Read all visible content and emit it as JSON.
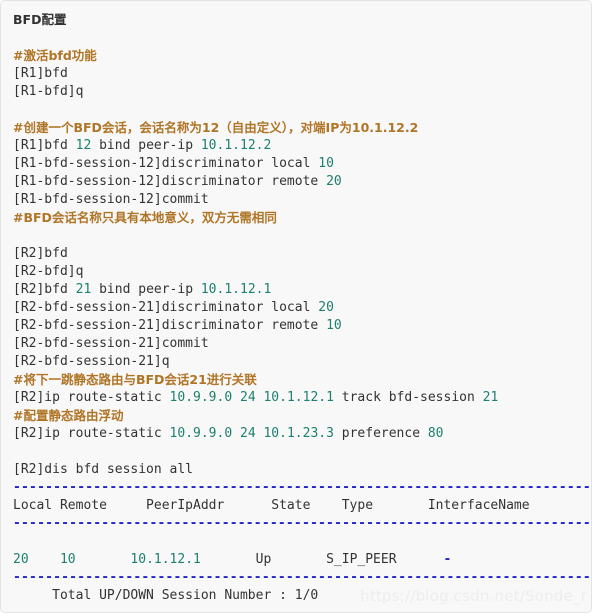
{
  "document": {
    "title": "BFD配置",
    "watermark": "https://blog.csdn.net/Sonde_r",
    "colors": {
      "background": "#f8f8f8",
      "border": "#e3e3e3",
      "code_text": "#333333",
      "comment": "#b07526",
      "number": "#1d7f6e",
      "separator": "#2222cc",
      "watermark": "#ededed"
    }
  },
  "lines": [
    {
      "id": "l01",
      "type": "title",
      "text": "BFD配置"
    },
    {
      "id": "l02",
      "type": "blank",
      "text": ""
    },
    {
      "id": "l03",
      "type": "comment",
      "text": "#激活bfd功能"
    },
    {
      "id": "l04",
      "type": "code",
      "text": "[R1]bfd"
    },
    {
      "id": "l05",
      "type": "code",
      "text": "[R1-bfd]q"
    },
    {
      "id": "l06",
      "type": "blank",
      "text": ""
    },
    {
      "id": "l07",
      "type": "comment",
      "text": "#创建一个BFD会话，会话名称为12（自由定义），对端IP为10.1.12.2"
    },
    {
      "id": "l08",
      "type": "code",
      "text": "[R1]bfd 12 bind peer-ip 10.1.12.2",
      "tokens": [
        {
          "t": "[R1]bfd ",
          "k": "plain"
        },
        {
          "t": "12",
          "k": "num"
        },
        {
          "t": " bind peer-ip ",
          "k": "plain"
        },
        {
          "t": "10.1.12.2",
          "k": "num"
        }
      ]
    },
    {
      "id": "l09",
      "type": "code",
      "text": "[R1-bfd-session-12]discriminator local 10",
      "tokens": [
        {
          "t": "[R1-bfd-session-12]discriminator local ",
          "k": "plain"
        },
        {
          "t": "10",
          "k": "num"
        }
      ]
    },
    {
      "id": "l10",
      "type": "code",
      "text": "[R1-bfd-session-12]discriminator remote 20",
      "tokens": [
        {
          "t": "[R1-bfd-session-12]discriminator remote ",
          "k": "plain"
        },
        {
          "t": "20",
          "k": "num"
        }
      ]
    },
    {
      "id": "l11",
      "type": "code",
      "text": "[R1-bfd-session-12]commit",
      "tokens": [
        {
          "t": "[R1-bfd-session-12]commit",
          "k": "plain"
        }
      ]
    },
    {
      "id": "l12",
      "type": "comment",
      "text": "#BFD会话名称只具有本地意义，双方无需相同"
    },
    {
      "id": "l13",
      "type": "blank",
      "text": ""
    },
    {
      "id": "l14",
      "type": "code",
      "text": "[R2]bfd",
      "tokens": [
        {
          "t": "[R2]bfd",
          "k": "plain"
        }
      ]
    },
    {
      "id": "l15",
      "type": "code",
      "text": "[R2-bfd]q",
      "tokens": [
        {
          "t": "[R2-bfd]q",
          "k": "plain"
        }
      ]
    },
    {
      "id": "l16",
      "type": "code",
      "text": "[R2]bfd 21 bind peer-ip 10.1.12.1",
      "tokens": [
        {
          "t": "[R2]bfd ",
          "k": "plain"
        },
        {
          "t": "21",
          "k": "num"
        },
        {
          "t": " bind peer-ip ",
          "k": "plain"
        },
        {
          "t": "10.1.12.1",
          "k": "num"
        }
      ]
    },
    {
      "id": "l17",
      "type": "code",
      "text": "[R2-bfd-session-21]discriminator local 20",
      "tokens": [
        {
          "t": "[R2-bfd-session-21]discriminator local ",
          "k": "plain"
        },
        {
          "t": "20",
          "k": "num"
        }
      ]
    },
    {
      "id": "l18",
      "type": "code",
      "text": "[R2-bfd-session-21]discriminator remote 10",
      "tokens": [
        {
          "t": "[R2-bfd-session-21]discriminator remote ",
          "k": "plain"
        },
        {
          "t": "10",
          "k": "num"
        }
      ]
    },
    {
      "id": "l19",
      "type": "code",
      "text": "[R2-bfd-session-21]commit",
      "tokens": [
        {
          "t": "[R2-bfd-session-21]commit",
          "k": "plain"
        }
      ]
    },
    {
      "id": "l20",
      "type": "code",
      "text": "[R2-bfd-session-21]q",
      "tokens": [
        {
          "t": "[R2-bfd-session-21]q",
          "k": "plain"
        }
      ]
    },
    {
      "id": "l21",
      "type": "comment",
      "text": "#将下一跳静态路由与BFD会话21进行关联"
    },
    {
      "id": "l22",
      "type": "code",
      "text": "[R2]ip route-static 10.9.9.0 24 10.1.12.1 track bfd-session 21",
      "tokens": [
        {
          "t": "[R2]ip route-static ",
          "k": "plain"
        },
        {
          "t": "10.9.9.0",
          "k": "num"
        },
        {
          "t": " ",
          "k": "plain"
        },
        {
          "t": "24",
          "k": "num"
        },
        {
          "t": " ",
          "k": "plain"
        },
        {
          "t": "10.1.12.1",
          "k": "num"
        },
        {
          "t": " track bfd-session ",
          "k": "plain"
        },
        {
          "t": "21",
          "k": "num"
        }
      ]
    },
    {
      "id": "l23",
      "type": "comment",
      "text": "#配置静态路由浮动"
    },
    {
      "id": "l24",
      "type": "code",
      "text": "[R2]ip route-static 10.9.9.0 24 10.1.23.3 preference 80",
      "tokens": [
        {
          "t": "[R2]ip route-static ",
          "k": "plain"
        },
        {
          "t": "10.9.9.0",
          "k": "num"
        },
        {
          "t": " ",
          "k": "plain"
        },
        {
          "t": "24",
          "k": "num"
        },
        {
          "t": " ",
          "k": "plain"
        },
        {
          "t": "10.1.23.3",
          "k": "num"
        },
        {
          "t": " preference ",
          "k": "plain"
        },
        {
          "t": "80",
          "k": "num"
        }
      ]
    },
    {
      "id": "l25",
      "type": "blank",
      "text": ""
    },
    {
      "id": "l26",
      "type": "code",
      "text": "[R2]dis bfd session all",
      "tokens": [
        {
          "t": "[R2]dis bfd session all",
          "k": "plain"
        }
      ]
    },
    {
      "id": "l27",
      "type": "separator",
      "text": "--------------------------------------------------------------------------------"
    },
    {
      "id": "l28",
      "type": "code",
      "text": "Local Remote     PeerIpAddr      State    Type       InterfaceName",
      "tokens": [
        {
          "t": "Local Remote     PeerIpAddr      State    Type       InterfaceName",
          "k": "plain"
        }
      ]
    },
    {
      "id": "l29",
      "type": "separator",
      "text": "--------------------------------------------------------------------------------"
    },
    {
      "id": "l30",
      "type": "blank",
      "text": ""
    },
    {
      "id": "l31",
      "type": "code",
      "text": "20    10       10.1.12.1       Up       S_IP_PEER      -",
      "tokens": [
        {
          "t": "20",
          "k": "num"
        },
        {
          "t": "    ",
          "k": "plain"
        },
        {
          "t": "10",
          "k": "num"
        },
        {
          "t": "       ",
          "k": "plain"
        },
        {
          "t": "10.1.12.1",
          "k": "num"
        },
        {
          "t": "       Up       S_IP_PEER      ",
          "k": "plain"
        },
        {
          "t": "-",
          "k": "dash"
        }
      ]
    },
    {
      "id": "l32",
      "type": "separator",
      "text": "--------------------------------------------------------------------------------"
    },
    {
      "id": "l33",
      "type": "code",
      "text": "     Total UP/DOWN Session Number : 1/0",
      "tokens": [
        {
          "t": "     Total UP/DOWN Session Number : 1/0",
          "k": "plain"
        }
      ]
    }
  ],
  "table": {
    "headers": [
      "Local",
      "Remote",
      "PeerIpAddr",
      "State",
      "Type",
      "InterfaceName"
    ],
    "rows": [
      [
        "20",
        "10",
        "10.1.12.1",
        "Up",
        "S_IP_PEER",
        "-"
      ]
    ],
    "summary_label": "Total UP/DOWN Session Number :",
    "summary_value": "1/0"
  }
}
